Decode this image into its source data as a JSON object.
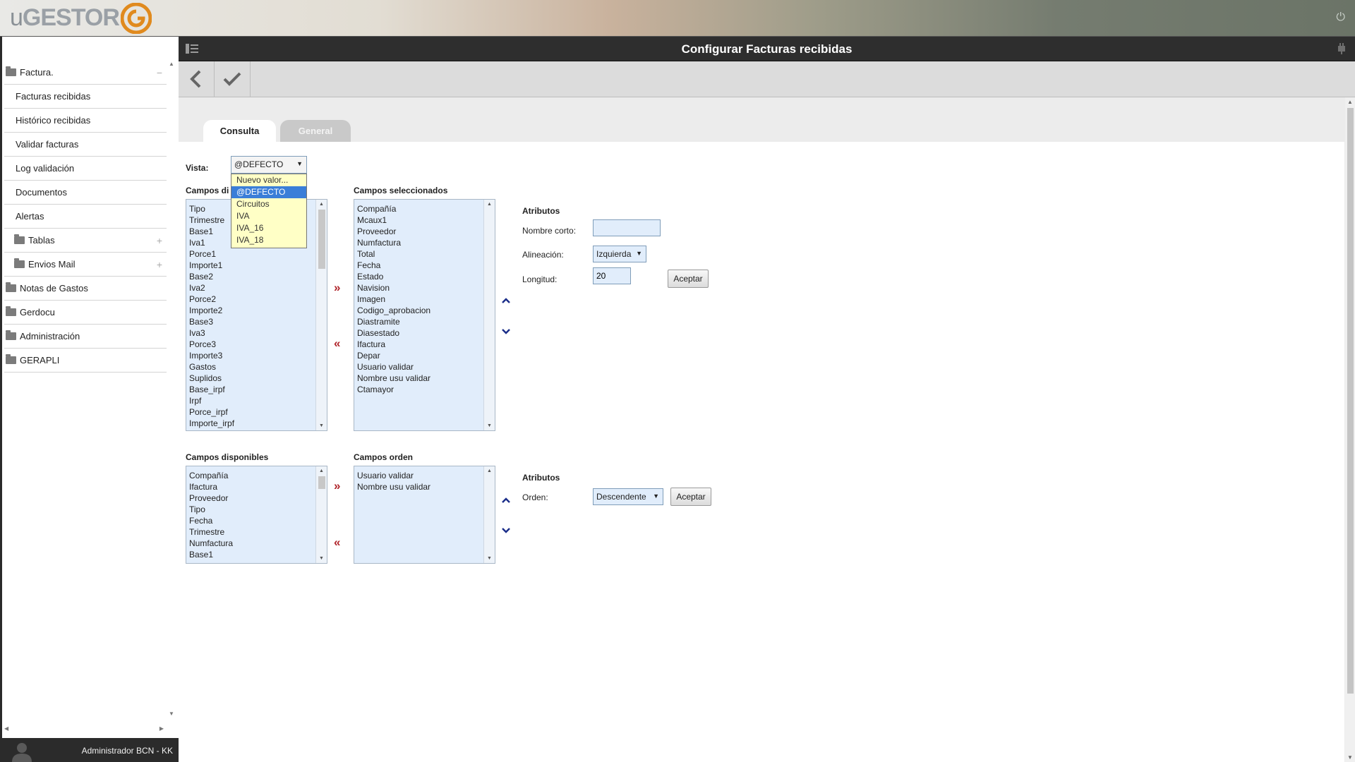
{
  "app": {
    "logo_text_u": "u",
    "logo_text_main": "GESTOR"
  },
  "header": {
    "power_icon": "power-icon"
  },
  "sidebar": {
    "items": [
      {
        "label": "Factura.",
        "type": "folder",
        "sign": "−"
      },
      {
        "label": "Facturas recibidas",
        "type": "child"
      },
      {
        "label": "Histórico recibidas",
        "type": "child"
      },
      {
        "label": "Validar facturas",
        "type": "child"
      },
      {
        "label": "Log validación",
        "type": "child"
      },
      {
        "label": "Documentos",
        "type": "child"
      },
      {
        "label": "Alertas",
        "type": "child"
      },
      {
        "label": "Tablas",
        "type": "subfolder",
        "sign": "+"
      },
      {
        "label": "Envios Mail",
        "type": "subfolder",
        "sign": "+"
      },
      {
        "label": "Notas de Gastos",
        "type": "folder"
      },
      {
        "label": "Gerdocu",
        "type": "folder"
      },
      {
        "label": "Administración",
        "type": "folder"
      },
      {
        "label": "GERAPLI",
        "type": "folder"
      }
    ],
    "footer_user": "Administrador BCN - KK"
  },
  "titlebar": {
    "title": "Configurar Facturas recibidas"
  },
  "tabs": {
    "consulta": "Consulta",
    "general": "General"
  },
  "vista": {
    "label": "Vista:",
    "selected": "@DEFECTO",
    "options": [
      "Nuevo valor...",
      "@DEFECTO",
      "Circuitos",
      "IVA",
      "IVA_16",
      "IVA_18"
    ]
  },
  "section1": {
    "available_title": "Campos disponibles",
    "available_visible_title": "Campos di",
    "available": [
      "Tipo",
      "Trimestre",
      "Base1",
      "Iva1",
      "Porce1",
      "Importe1",
      "Base2",
      "Iva2",
      "Porce2",
      "Importe2",
      "Base3",
      "Iva3",
      "Porce3",
      "Importe3",
      "Gastos",
      "Suplidos",
      "Base_irpf",
      "Irpf",
      "Porce_irpf",
      "Importe_irpf"
    ],
    "selected_title": "Campos seleccionados",
    "selected": [
      "Compañía",
      "Mcaux1",
      "Proveedor",
      "Numfactura",
      "Total",
      "Fecha",
      "Estado",
      "Navision",
      "Imagen",
      "Codigo_aprobacion",
      "Diastramite",
      "Diasestado",
      "Ifactura",
      "Depar",
      "Usuario validar",
      "Nombre usu validar",
      "Ctamayor"
    ],
    "atributos": {
      "title": "Atributos",
      "nombre_corto_label": "Nombre corto:",
      "nombre_corto_value": "",
      "alineacion_label": "Alineación:",
      "alineacion_value": "Izquierda",
      "longitud_label": "Longitud:",
      "longitud_value": "20",
      "aceptar": "Aceptar"
    }
  },
  "section2": {
    "available_title": "Campos disponibles",
    "available": [
      "Compañía",
      "Ifactura",
      "Proveedor",
      "Tipo",
      "Fecha",
      "Trimestre",
      "Numfactura",
      "Base1"
    ],
    "order_title": "Campos orden",
    "order": [
      "Usuario validar",
      "Nombre usu validar"
    ],
    "atributos": {
      "title": "Atributos",
      "orden_label": "Orden:",
      "orden_value": "Descendente",
      "aceptar": "Aceptar"
    }
  },
  "move_right_glyph": "»",
  "move_left_glyph": "«"
}
